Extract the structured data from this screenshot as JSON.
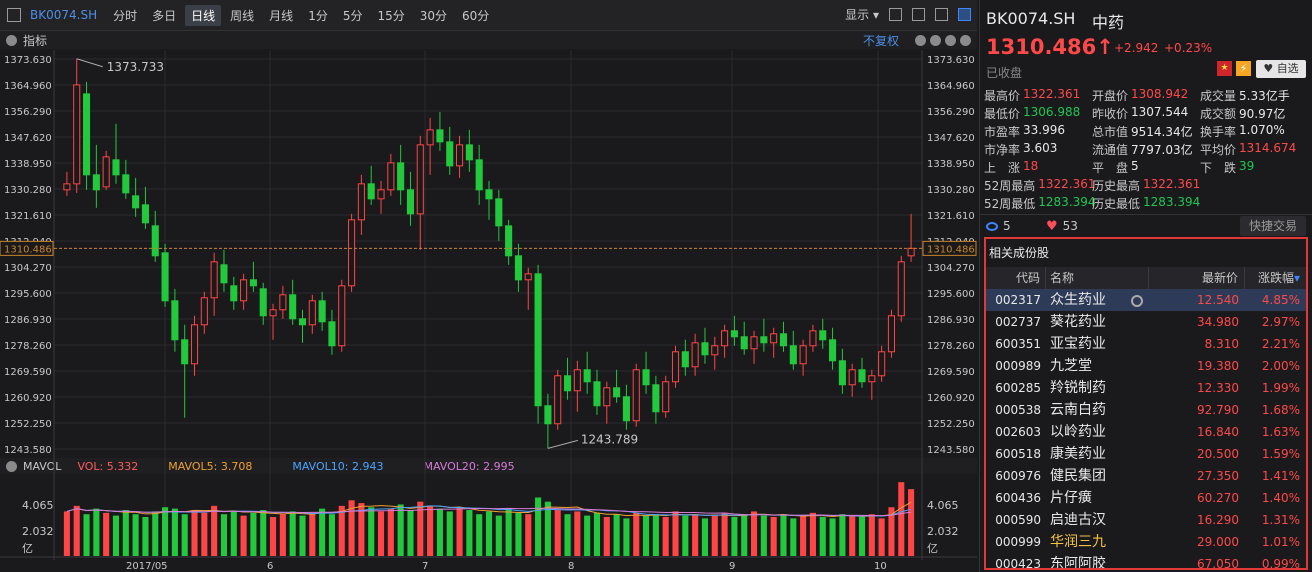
{
  "toolbar": {
    "code": "BK0074.SH",
    "tabs": [
      "分时",
      "多日",
      "日线",
      "周线",
      "月线",
      "1分",
      "5分",
      "15分",
      "30分",
      "60分"
    ],
    "active_tab": "日线",
    "show_label": "显示"
  },
  "main_panel": {
    "header_label": "指标",
    "adjust_label": "不复权",
    "current_price_tag": "1310.486",
    "high_annotation": "1373.733",
    "low_annotation": "1243.789",
    "y_ticks": [
      "1373.630",
      "1364.960",
      "1356.290",
      "1347.620",
      "1338.950",
      "1330.280",
      "1321.610",
      "1312.940",
      "1304.270",
      "1295.600",
      "1286.930",
      "1278.260",
      "1269.590",
      "1260.920",
      "1252.250",
      "1243.580"
    ]
  },
  "volume_panel": {
    "name": "MAVOL",
    "vol": "VOL: 5.332",
    "mavol5": "MAVOL5: 3.708",
    "mavol10": "MAVOL10: 2.943",
    "mavol20": "MAVOL20: 2.995",
    "y_ticks": [
      "4.065",
      "2.032"
    ],
    "unit": "亿",
    "x_labels": [
      "2017/05",
      "6",
      "7",
      "8",
      "9",
      "10"
    ]
  },
  "quote": {
    "code": "BK0074.SH",
    "name": "中药",
    "price": "1310.486",
    "arrow": "↑",
    "change": "+2.942",
    "change_pct": "+0.23%",
    "status": "已收盘",
    "fav_label": "自选",
    "stats": [
      [
        {
          "k": "最高价",
          "v": "1322.361",
          "c": "red"
        },
        {
          "k": "开盘价",
          "v": "1308.942",
          "c": "red"
        },
        {
          "k": "成交量",
          "v": "5.33亿手",
          "c": "white"
        }
      ],
      [
        {
          "k": "最低价",
          "v": "1306.988",
          "c": "green"
        },
        {
          "k": "昨收价",
          "v": "1307.544",
          "c": "white"
        },
        {
          "k": "成交额",
          "v": "90.97亿",
          "c": "white"
        }
      ],
      [
        {
          "k": "市盈率",
          "v": "33.996",
          "c": "white"
        },
        {
          "k": "总市值",
          "v": "9514.34亿",
          "c": "white"
        },
        {
          "k": "换手率",
          "v": "1.070%",
          "c": "white"
        }
      ],
      [
        {
          "k": "市净率",
          "v": "3.603",
          "c": "white"
        },
        {
          "k": "流通值",
          "v": "7797.03亿",
          "c": "white"
        },
        {
          "k": "平均价",
          "v": "1314.674",
          "c": "red"
        }
      ],
      [
        {
          "k": "上　涨",
          "v": "18",
          "c": "red"
        },
        {
          "k": "平　盘",
          "v": "5",
          "c": "white"
        },
        {
          "k": "下　跌",
          "v": "39",
          "c": "green"
        }
      ],
      [
        {
          "k": "52周最高",
          "v": "1322.361",
          "c": "red"
        },
        {
          "k": "历史最高",
          "v": "1322.361",
          "c": "red"
        }
      ],
      [
        {
          "k": "52周最低",
          "v": "1283.394",
          "c": "green"
        },
        {
          "k": "历史最低",
          "v": "1283.394",
          "c": "green"
        }
      ]
    ],
    "watchers": "5",
    "likes": "53",
    "quick_trade": "快捷交易"
  },
  "related": {
    "title": "相关成份股",
    "headers": {
      "code": "代码",
      "name": "名称",
      "price": "最新价",
      "pct": "涨跌幅"
    },
    "rows": [
      {
        "code": "002317",
        "name": "众生药业",
        "price": "12.540",
        "pct": "4.85%",
        "name_color": "white"
      },
      {
        "code": "002737",
        "name": "葵花药业",
        "price": "34.980",
        "pct": "2.97%",
        "name_color": "white"
      },
      {
        "code": "600351",
        "name": "亚宝药业",
        "price": "8.310",
        "pct": "2.21%",
        "name_color": "white"
      },
      {
        "code": "000989",
        "name": "九芝堂",
        "price": "19.380",
        "pct": "2.00%",
        "name_color": "white"
      },
      {
        "code": "600285",
        "name": "羚锐制药",
        "price": "12.330",
        "pct": "1.99%",
        "name_color": "white"
      },
      {
        "code": "000538",
        "name": "云南白药",
        "price": "92.790",
        "pct": "1.68%",
        "name_color": "white"
      },
      {
        "code": "002603",
        "name": "以岭药业",
        "price": "16.840",
        "pct": "1.63%",
        "name_color": "white"
      },
      {
        "code": "600518",
        "name": "康美药业",
        "price": "20.500",
        "pct": "1.59%",
        "name_color": "white"
      },
      {
        "code": "600976",
        "name": "健民集团",
        "price": "27.350",
        "pct": "1.41%",
        "name_color": "white"
      },
      {
        "code": "600436",
        "name": "片仔癀",
        "price": "60.270",
        "pct": "1.40%",
        "name_color": "white"
      },
      {
        "code": "000590",
        "name": "启迪古汉",
        "price": "16.290",
        "pct": "1.31%",
        "name_color": "white"
      },
      {
        "code": "000999",
        "name": "华润三九",
        "price": "29.000",
        "pct": "1.01%",
        "name_color": "yellow"
      },
      {
        "code": "000423",
        "name": "东阿阿胶",
        "price": "67.050",
        "pct": "0.99%",
        "name_color": "white"
      }
    ]
  },
  "chart_data": {
    "type": "candlestick",
    "ylim": [
      1243.58,
      1373.63
    ],
    "candles": [
      [
        1330,
        1336,
        1328,
        1332
      ],
      [
        1332,
        1373.7,
        1329,
        1365
      ],
      [
        1362,
        1366,
        1330,
        1335
      ],
      [
        1335,
        1345,
        1324,
        1330
      ],
      [
        1331,
        1343,
        1330,
        1341
      ],
      [
        1340,
        1352,
        1332,
        1335
      ],
      [
        1335,
        1340,
        1327,
        1329
      ],
      [
        1328,
        1334,
        1321,
        1324
      ],
      [
        1325,
        1331,
        1317,
        1319
      ],
      [
        1318,
        1323,
        1306,
        1308
      ],
      [
        1309,
        1312,
        1291,
        1293
      ],
      [
        1293,
        1297,
        1276,
        1280
      ],
      [
        1280,
        1285,
        1254,
        1272
      ],
      [
        1272,
        1288,
        1268,
        1285
      ],
      [
        1285,
        1296,
        1282,
        1294
      ],
      [
        1294,
        1309,
        1288,
        1306
      ],
      [
        1305,
        1310,
        1296,
        1299
      ],
      [
        1298,
        1301,
        1290,
        1293
      ],
      [
        1293,
        1302,
        1290,
        1300
      ],
      [
        1300,
        1306,
        1296,
        1298
      ],
      [
        1297,
        1299,
        1285,
        1288
      ],
      [
        1288,
        1292,
        1280,
        1290
      ],
      [
        1290,
        1298,
        1287,
        1295
      ],
      [
        1295,
        1300,
        1285,
        1287
      ],
      [
        1287,
        1290,
        1279,
        1285
      ],
      [
        1285,
        1295,
        1282,
        1293
      ],
      [
        1293,
        1296,
        1283,
        1286
      ],
      [
        1286,
        1290,
        1275,
        1278
      ],
      [
        1278,
        1300,
        1276,
        1298
      ],
      [
        1298,
        1322,
        1296,
        1320
      ],
      [
        1320,
        1335,
        1315,
        1332
      ],
      [
        1332,
        1338,
        1325,
        1327
      ],
      [
        1327,
        1333,
        1322,
        1330
      ],
      [
        1330,
        1342,
        1328,
        1339
      ],
      [
        1339,
        1345,
        1325,
        1330
      ],
      [
        1330,
        1336,
        1318,
        1322
      ],
      [
        1322,
        1348,
        1310,
        1345
      ],
      [
        1345,
        1354,
        1335,
        1350
      ],
      [
        1350,
        1356,
        1343,
        1346
      ],
      [
        1346,
        1351,
        1335,
        1338
      ],
      [
        1338,
        1348,
        1334,
        1345
      ],
      [
        1345,
        1350,
        1336,
        1340
      ],
      [
        1340,
        1345,
        1325,
        1330
      ],
      [
        1330,
        1333,
        1320,
        1327
      ],
      [
        1327,
        1330,
        1313,
        1318
      ],
      [
        1318,
        1320,
        1305,
        1308
      ],
      [
        1308,
        1312,
        1296,
        1300
      ],
      [
        1300,
        1304,
        1290,
        1302
      ],
      [
        1302,
        1305,
        1252,
        1258
      ],
      [
        1258,
        1262,
        1243.8,
        1252
      ],
      [
        1252,
        1270,
        1250,
        1268
      ],
      [
        1268,
        1274,
        1260,
        1263
      ],
      [
        1263,
        1273,
        1256,
        1270
      ],
      [
        1270,
        1276,
        1262,
        1266
      ],
      [
        1266,
        1270,
        1255,
        1258
      ],
      [
        1258,
        1266,
        1252,
        1264
      ],
      [
        1264,
        1270,
        1259,
        1261
      ],
      [
        1261,
        1265,
        1250,
        1253
      ],
      [
        1253,
        1272,
        1251,
        1270
      ],
      [
        1270,
        1276,
        1262,
        1265
      ],
      [
        1265,
        1268,
        1252,
        1256
      ],
      [
        1256,
        1268,
        1254,
        1266
      ],
      [
        1266,
        1278,
        1264,
        1276
      ],
      [
        1276,
        1280,
        1268,
        1271
      ],
      [
        1271,
        1282,
        1268,
        1279
      ],
      [
        1279,
        1284,
        1272,
        1275
      ],
      [
        1275,
        1281,
        1270,
        1278
      ],
      [
        1278,
        1285,
        1274,
        1283
      ],
      [
        1283,
        1288,
        1278,
        1281
      ],
      [
        1281,
        1286,
        1275,
        1277
      ],
      [
        1277,
        1283,
        1272,
        1281
      ],
      [
        1281,
        1287,
        1276,
        1279
      ],
      [
        1279,
        1284,
        1274,
        1282
      ],
      [
        1282,
        1286,
        1276,
        1278
      ],
      [
        1278,
        1283,
        1270,
        1272
      ],
      [
        1272,
        1280,
        1268,
        1278
      ],
      [
        1278,
        1285,
        1276,
        1283
      ],
      [
        1283,
        1287,
        1277,
        1280
      ],
      [
        1280,
        1284,
        1270,
        1273
      ],
      [
        1273,
        1277,
        1262,
        1265
      ],
      [
        1265,
        1272,
        1261,
        1270
      ],
      [
        1270,
        1274,
        1264,
        1266
      ],
      [
        1266,
        1270,
        1260,
        1268
      ],
      [
        1268,
        1278,
        1266,
        1276
      ],
      [
        1276,
        1290,
        1274,
        1288
      ],
      [
        1288,
        1308,
        1286,
        1306
      ],
      [
        1308,
        1322,
        1306,
        1310.5
      ]
    ],
    "volumes": [
      3.2,
      3.6,
      3.0,
      3.4,
      3.1,
      2.9,
      3.3,
      3.0,
      2.8,
      3.2,
      3.5,
      3.4,
      3.0,
      3.3,
      3.1,
      3.6,
      3.0,
      3.2,
      2.9,
      3.1,
      3.3,
      2.8,
      3.0,
      3.2,
      2.9,
      3.1,
      3.4,
      3.0,
      3.6,
      4.0,
      3.8,
      3.5,
      3.2,
      3.4,
      3.7,
      3.3,
      3.9,
      3.6,
      3.4,
      3.2,
      3.5,
      3.3,
      3.0,
      3.2,
      2.9,
      3.4,
      3.1,
      3.0,
      4.2,
      3.9,
      3.3,
      3.0,
      3.2,
      2.9,
      3.1,
      2.8,
      3.0,
      2.7,
      3.1,
      2.9,
      3.0,
      2.8,
      3.2,
      2.9,
      3.0,
      2.7,
      2.9,
      3.1,
      2.8,
      3.0,
      3.2,
      2.9,
      2.8,
      3.0,
      2.7,
      2.9,
      3.1,
      2.8,
      2.7,
      3.0,
      2.9,
      2.8,
      3.0,
      2.7,
      3.5,
      5.3,
      4.8
    ],
    "annotations": [
      {
        "label": "1373.733"
      },
      {
        "label": "1243.789"
      }
    ],
    "current": 1310.486
  }
}
